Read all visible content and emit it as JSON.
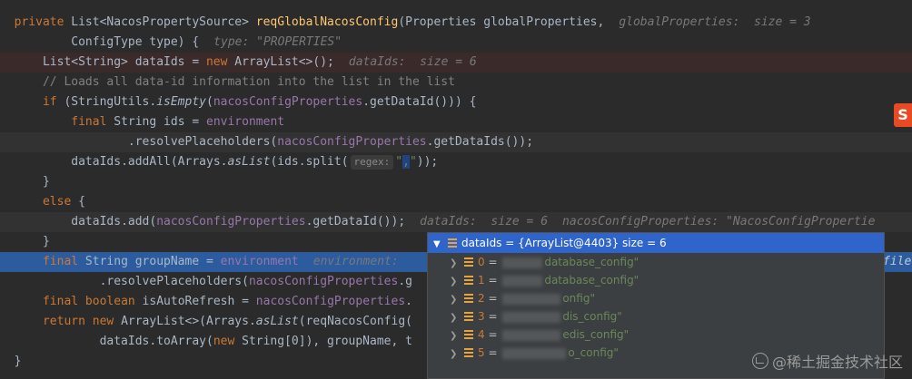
{
  "code": {
    "l1": {
      "private": "private",
      "type": "List<NacosPropertySource> ",
      "method": "reqGlobalNacosConfig",
      "params": "(Properties globalProperties,",
      "hint": "globalProperties:  size = 3"
    },
    "l2": {
      "text": "ConfigType type) {",
      "hint": "type: \"PROPERTIES\""
    },
    "l3": {
      "type": "List<String> dataIds = ",
      "new": "new",
      "rest": " ArrayList<>();",
      "hint": "dataIds:  size = 6"
    },
    "l4": {
      "comment": "// Loads all data-id information into the list in the list"
    },
    "l5": {
      "if": "if",
      "a": " (StringUtils.",
      "isEmpty": "isEmpty",
      "b": "(",
      "field": "nacosConfigProperties",
      "c": ".getDataId())) {"
    },
    "l6": {
      "final": "final",
      "a": " String ids = ",
      "env": "environment"
    },
    "l7": {
      "a": ".resolvePlaceholders(",
      "field": "nacosConfigProperties",
      "b": ".getDataIds());"
    },
    "l8": {
      "a": "dataIds.addAll(Arrays.",
      "asList": "asList",
      "b": "(ids.split(",
      "param": "regex:",
      "q1": "\"",
      "sep": ",",
      "q2": "\"",
      "c": "));"
    },
    "l9": {
      "text": "}"
    },
    "l10": {
      "else": "else",
      "text": " {"
    },
    "l11": {
      "a": "dataIds.add(",
      "field": "nacosConfigProperties",
      "b": ".getDataId());",
      "hint1": "dataIds:  size = 6",
      "hint2": "nacosConfigProperties: \"NacosConfigPropertie"
    },
    "l12": {
      "text": "}"
    },
    "l13": {
      "final": "final",
      "a": " String groupName = ",
      "env": "environment",
      "hint": "environment:",
      "tail": "file"
    },
    "l14": {
      "a": ".resolvePlaceholders(",
      "field": "nacosConfigProperties",
      "b": ".g"
    },
    "l15": {
      "final": "final",
      "bool": " boolean",
      "a": " isAutoRefresh = ",
      "field": "nacosConfigProperties",
      "b": "."
    },
    "l16": {
      "return": "return",
      "a": " ",
      "new": "new",
      "b": " ArrayList<>(Arrays.",
      "asList": "asList",
      "c": "(reqNacosConfig("
    },
    "l17": {
      "a": "dataIds.toArray(",
      "new": "new",
      "b": " String[0]), groupName, t"
    },
    "l18": {
      "text": "}"
    }
  },
  "debugger": {
    "header": "dataIds = {ArrayList@4403}  size = 6",
    "items": [
      {
        "index": "0",
        "value": "database_config\""
      },
      {
        "index": "1",
        "value": "database_config\""
      },
      {
        "index": "2",
        "value": "onfig\""
      },
      {
        "index": "3",
        "value": "dis_config\""
      },
      {
        "index": "4",
        "value": "edis_config\""
      },
      {
        "index": "5",
        "value": "o_config\""
      }
    ]
  },
  "watermark": "@稀土掘金技术社区",
  "logo_text": "S",
  "colors": {
    "exec_line": "#2d5c9e",
    "popup_header": "#2f65ca",
    "keyword": "#cc7832",
    "field": "#9876aa"
  }
}
